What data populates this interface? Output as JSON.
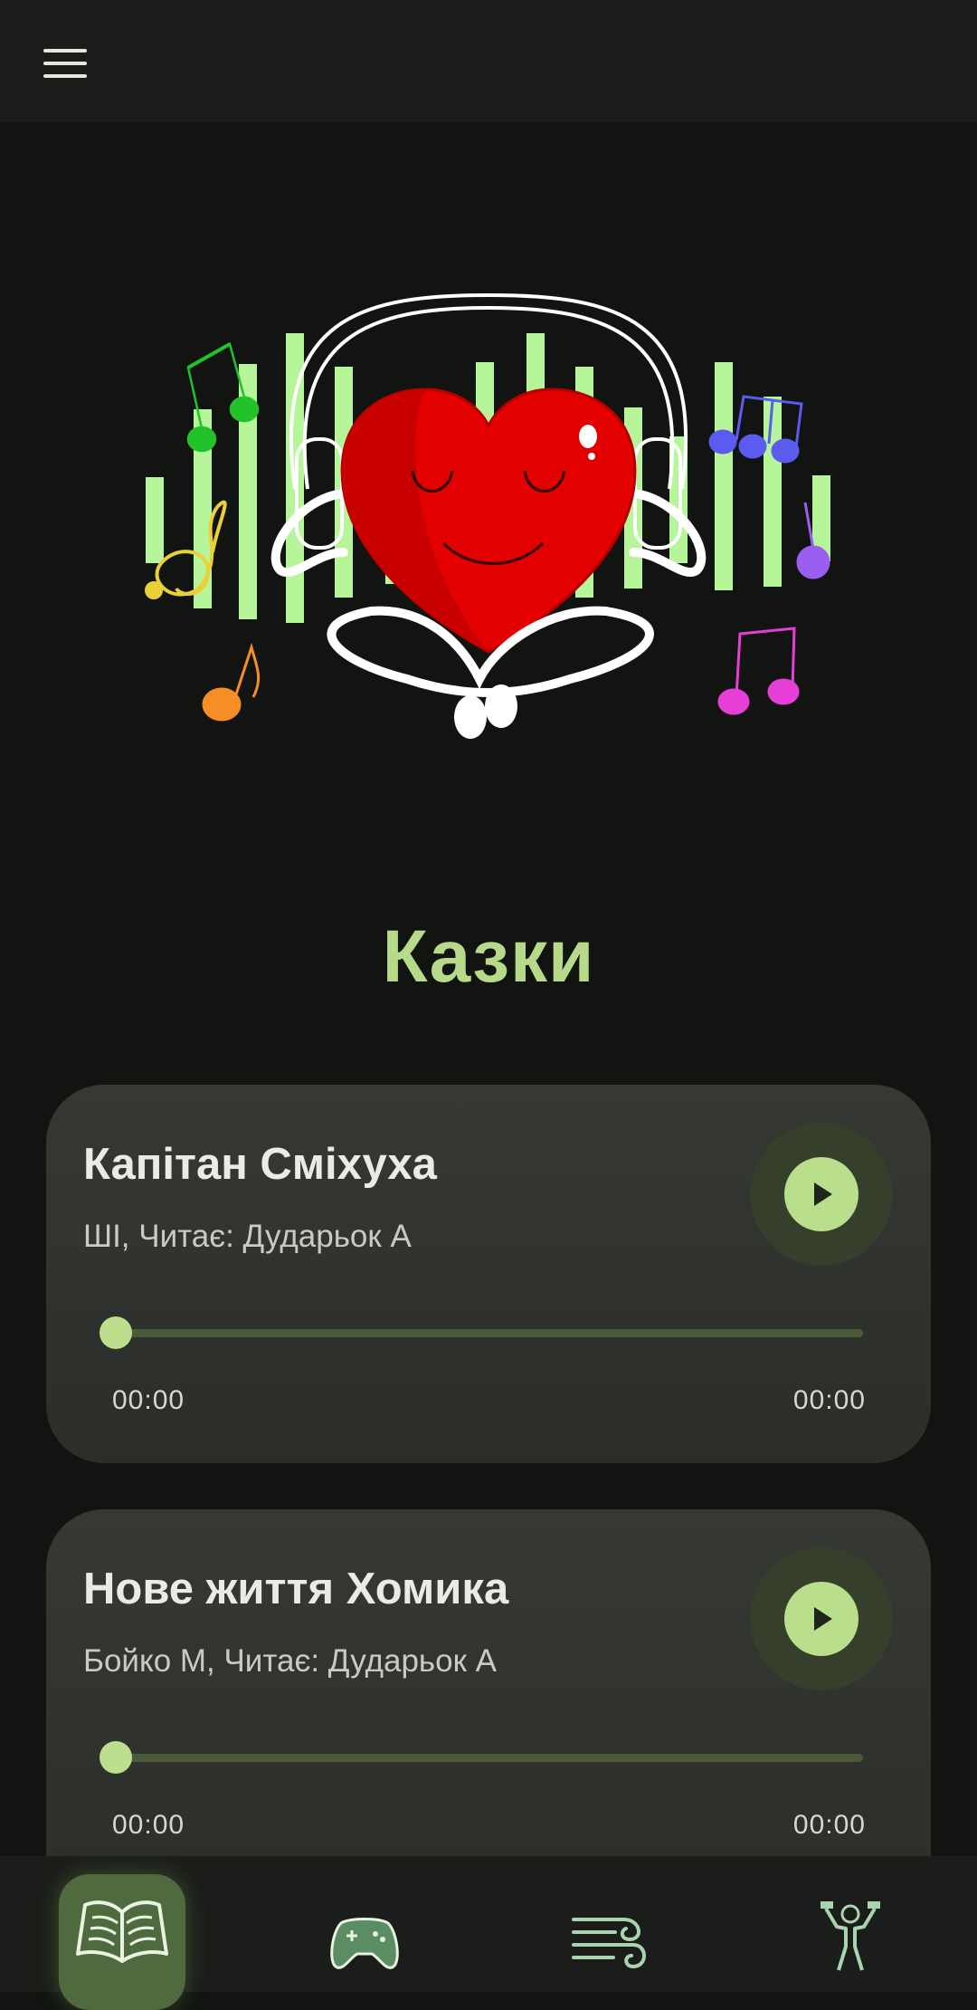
{
  "app": {
    "page_title": "Казки"
  },
  "colors": {
    "accent": "#b9de8c",
    "background": "#111410",
    "card": "#30322e",
    "bar": "#b6f59a"
  },
  "header": {
    "menu_icon": "hamburger-menu-icon"
  },
  "tales": [
    {
      "title": "Капітан Сміхуха",
      "subtitle": "ШІ, Читає: Дударьок А",
      "current_time": "00:00",
      "duration": "00:00",
      "progress": 0
    },
    {
      "title": "Нове життя Хомика",
      "subtitle": "Бойко М, Читає: Дударьок А",
      "current_time": "00:00",
      "duration": "00:00",
      "progress": 0
    }
  ],
  "bottom_nav": {
    "items": [
      {
        "icon": "book-icon",
        "active": true
      },
      {
        "icon": "gamepad-icon",
        "active": false
      },
      {
        "icon": "wind-icon",
        "active": false
      },
      {
        "icon": "exercise-icon",
        "active": false
      }
    ]
  }
}
